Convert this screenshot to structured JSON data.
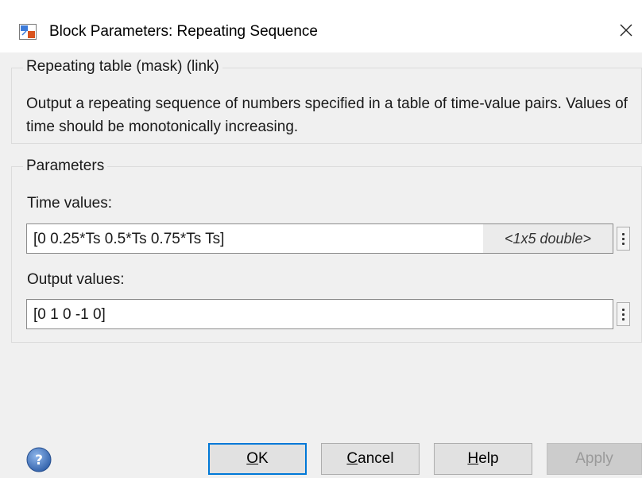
{
  "window": {
    "title": "Block Parameters: Repeating Sequence",
    "app_icon": "simulink-block-icon",
    "close_glyph": "×"
  },
  "description": {
    "group_title": "Repeating table (mask) (link)",
    "text": "Output a repeating sequence of numbers specified in a table of time-value pairs. Values of time should be monotonically increasing."
  },
  "parameters": {
    "group_title": "Parameters",
    "fields": [
      {
        "label": "Time values:",
        "value": "[0 0.25*Ts 0.5*Ts 0.75*Ts Ts]",
        "type_hint": "<1x5 double>"
      },
      {
        "label": "Output values:",
        "value": "[0 1 0 -1 0]"
      }
    ]
  },
  "buttons": {
    "ok": {
      "label": "OK",
      "mnemonic": "O",
      "rest": "K"
    },
    "cancel": {
      "label": "Cancel",
      "mnemonic": "C",
      "rest": "ancel"
    },
    "help": {
      "label": "Help",
      "mnemonic": "H",
      "rest": "elp"
    },
    "apply": {
      "label": "Apply",
      "enabled": false
    }
  },
  "colors": {
    "accent": "#0078d7",
    "dialog_bg": "#f0f0f0",
    "help_icon": "#3b6fb6"
  }
}
